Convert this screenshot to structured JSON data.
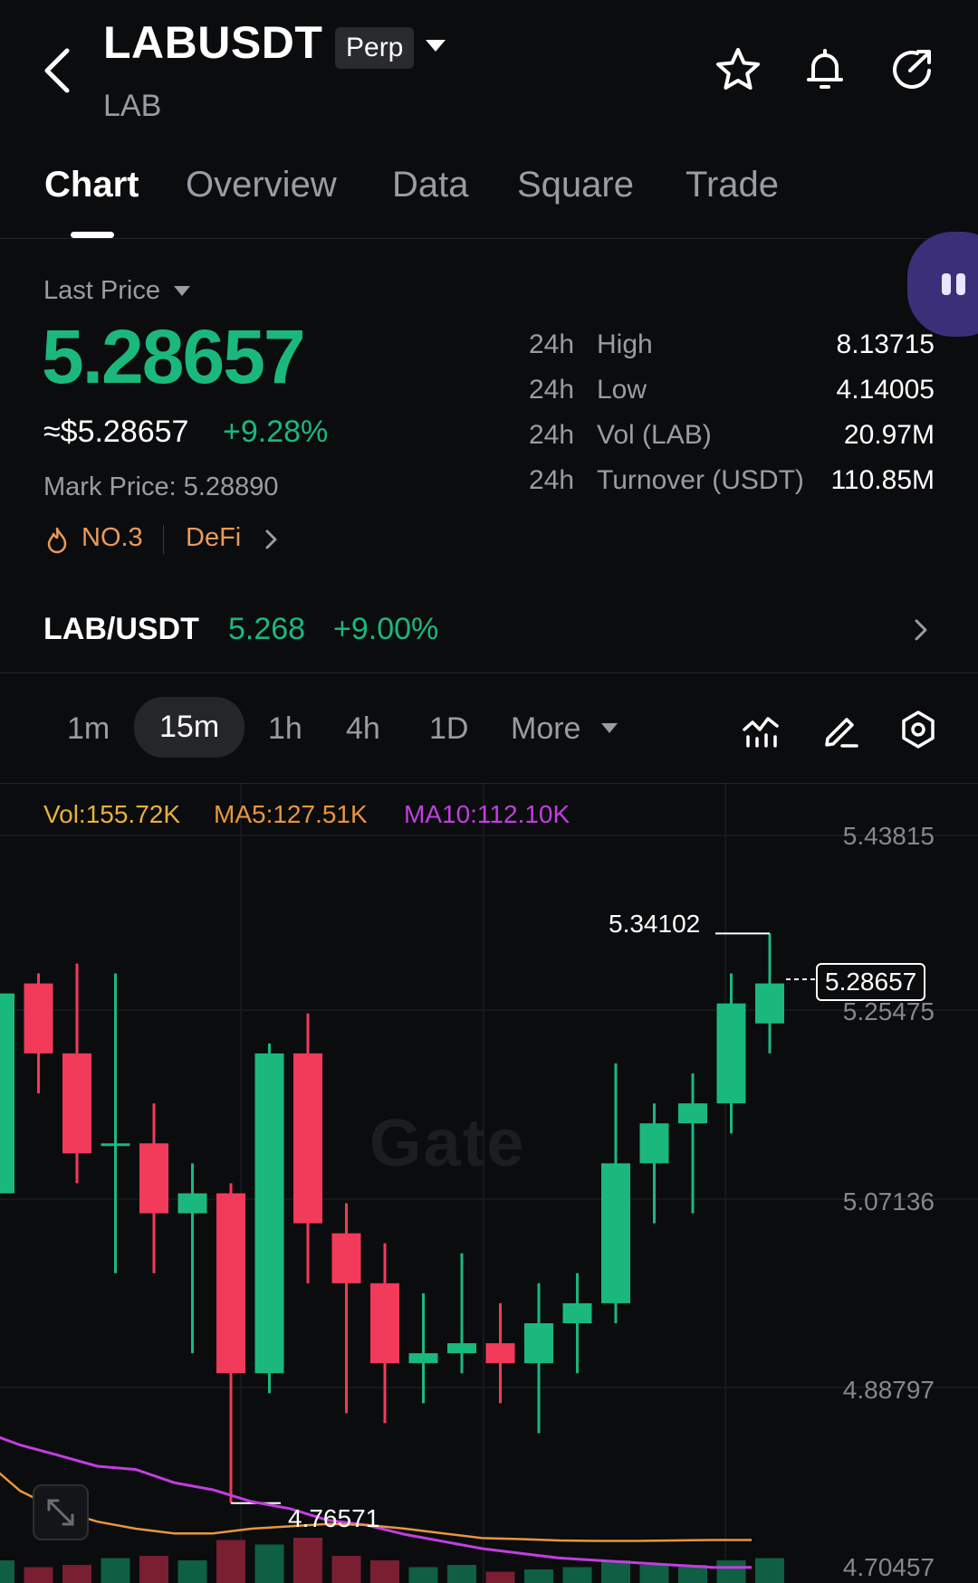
{
  "header": {
    "title": "LABUSDT",
    "badge": "Perp",
    "subtitle": "LAB",
    "icons": [
      "back-arrow-icon",
      "star-icon",
      "bell-icon",
      "share-icon"
    ]
  },
  "tabs": [
    {
      "label": "Chart",
      "active": true
    },
    {
      "label": "Overview",
      "active": false
    },
    {
      "label": "Data",
      "active": false
    },
    {
      "label": "Square",
      "active": false
    },
    {
      "label": "Trade",
      "active": false
    }
  ],
  "price": {
    "label": "Last Price",
    "value": "5.28657",
    "usd": "≈$5.28657",
    "change": "+9.28%",
    "mark": "Mark Price: 5.28890",
    "rank": "NO.3",
    "category": "DeFi"
  },
  "stats": [
    {
      "period": "24h",
      "name": "High",
      "value": "8.13715"
    },
    {
      "period": "24h",
      "name": "Low",
      "value": "4.14005"
    },
    {
      "period": "24h",
      "name": "Vol (LAB)",
      "value": "20.97M"
    },
    {
      "period": "24h",
      "name": "Turnover (USDT)",
      "value": "110.85M"
    }
  ],
  "spot": {
    "pair": "LAB/USDT",
    "price": "5.268",
    "change": "+9.00%"
  },
  "timeframes": [
    {
      "label": "1m",
      "active": false
    },
    {
      "label": "15m",
      "active": true
    },
    {
      "label": "1h",
      "active": false
    },
    {
      "label": "4h",
      "active": false
    },
    {
      "label": "1D",
      "active": false
    },
    {
      "label": "More",
      "active": false
    }
  ],
  "legend": {
    "vol": "Vol:155.72K",
    "ma5": "MA5:127.51K",
    "ma10": "MA10:112.10K"
  },
  "chart_data": {
    "type": "candlestick",
    "y_axis_labels": [
      "5.43815",
      "5.25475",
      "5.07136",
      "4.88797",
      "4.70457"
    ],
    "current_price_label": "5.28657",
    "high_marker": "5.34102",
    "low_marker": "4.76571",
    "watermark": "Gate",
    "candles": [
      {
        "o": 5.08,
        "c": 5.28,
        "h": 5.28,
        "l": 5.08
      },
      {
        "o": 5.29,
        "c": 5.22,
        "h": 5.3,
        "l": 5.18
      },
      {
        "o": 5.22,
        "c": 5.12,
        "h": 5.31,
        "l": 5.09
      },
      {
        "o": 5.13,
        "c": 5.13,
        "h": 5.3,
        "l": 5.0
      },
      {
        "o": 5.13,
        "c": 5.06,
        "h": 5.17,
        "l": 5.0
      },
      {
        "o": 5.06,
        "c": 5.08,
        "h": 5.11,
        "l": 4.92
      },
      {
        "o": 5.08,
        "c": 4.9,
        "h": 5.09,
        "l": 4.77
      },
      {
        "o": 4.9,
        "c": 5.22,
        "h": 5.23,
        "l": 4.88
      },
      {
        "o": 5.22,
        "c": 5.05,
        "h": 5.26,
        "l": 4.99
      },
      {
        "o": 5.04,
        "c": 4.99,
        "h": 5.07,
        "l": 4.86
      },
      {
        "o": 4.99,
        "c": 4.91,
        "h": 5.03,
        "l": 4.85
      },
      {
        "o": 4.91,
        "c": 4.92,
        "h": 4.98,
        "l": 4.87
      },
      {
        "o": 4.92,
        "c": 4.93,
        "h": 5.02,
        "l": 4.9
      },
      {
        "o": 4.93,
        "c": 4.91,
        "h": 4.97,
        "l": 4.87
      },
      {
        "o": 4.91,
        "c": 4.95,
        "h": 4.99,
        "l": 4.84
      },
      {
        "o": 4.95,
        "c": 4.97,
        "h": 5.0,
        "l": 4.9
      },
      {
        "o": 4.97,
        "c": 5.11,
        "h": 5.21,
        "l": 4.95
      },
      {
        "o": 5.11,
        "c": 5.15,
        "h": 5.17,
        "l": 5.05
      },
      {
        "o": 5.15,
        "c": 5.17,
        "h": 5.2,
        "l": 5.06
      },
      {
        "o": 5.17,
        "c": 5.27,
        "h": 5.3,
        "l": 5.14
      },
      {
        "o": 5.25,
        "c": 5.29,
        "h": 5.34,
        "l": 5.22
      }
    ],
    "volume": [
      0.5,
      0.35,
      0.4,
      0.55,
      0.6,
      0.5,
      0.95,
      0.85,
      1.0,
      0.6,
      0.5,
      0.35,
      0.4,
      0.25,
      0.3,
      0.35,
      0.5,
      0.4,
      0.4,
      0.5,
      0.55
    ]
  },
  "colors": {
    "up": "#1bb87e",
    "down": "#f23a5a",
    "ma5": "#e8963f",
    "ma10": "#c23ee0",
    "vol": "#e8b13f"
  }
}
